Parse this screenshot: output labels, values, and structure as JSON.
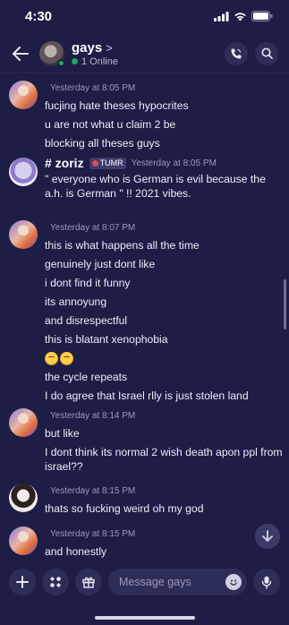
{
  "status_bar": {
    "time": "4:30"
  },
  "header": {
    "title": "gays",
    "chevron": ">",
    "online": "1 Online"
  },
  "messages": [
    {
      "timestamp": "Yesterday at 8:05 PM",
      "lines": [
        "fucjing hate theses hypocrites",
        "u are not what u claim 2 be",
        "blocking all theses guys"
      ]
    },
    {
      "username": "# zoriz",
      "tag": "TUMR",
      "timestamp": "Yesterday at 8:05 PM",
      "lines": [
        "\" everyone who is German is evil because the a.h. is German \" !! 2021 vibes."
      ]
    },
    {
      "timestamp": "Yesterday at 8:07 PM",
      "lines": [
        "this is what happens all the time",
        "genuinely just dont like",
        "i dont find it funny",
        "its annoyung",
        "and disrespectful",
        "this is blatant xenophobia",
        "the cycle repeats",
        "I do agree that Israel rlly is just stolen land"
      ]
    },
    {
      "timestamp": "Yesterday at 8:14 PM",
      "lines": [
        "but like",
        "I dont think its normal 2 wish death apon ppl from israel??"
      ]
    },
    {
      "timestamp": "Yesterday at 8:15 PM",
      "lines": [
        "thats so fucking weird oh my god"
      ]
    },
    {
      "timestamp": "Yesterday at 8:15 PM",
      "lines": [
        "and honestly"
      ]
    }
  ],
  "composer": {
    "placeholder": "Message gays"
  },
  "colors": {
    "background": "#1d1d46",
    "surface": "#2d2d5a",
    "online": "#23a55a"
  }
}
